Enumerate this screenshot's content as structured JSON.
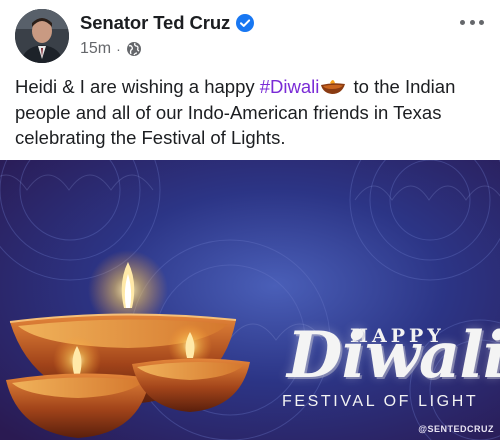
{
  "post": {
    "author": "Senator Ted Cruz",
    "timestamp": "15m",
    "separator": "·",
    "visibility_icon": "globe-icon",
    "text_before_hashtag": "Heidi & I are wishing a happy ",
    "hashtag": "#Diwali",
    "text_after_hashtag": " to the Indian people and all of our Indo-American friends in Texas celebrating the Festival of Lights."
  },
  "image": {
    "happy": "HAPPY",
    "diwali": "Diwali",
    "subtitle": "FESTIVAL OF LIGHT",
    "watermark": "@SENTEDCRUZ"
  },
  "colors": {
    "hashtag": "#7a2bd6",
    "verified_badge": "#1877f2",
    "meta_text": "#65676b"
  }
}
